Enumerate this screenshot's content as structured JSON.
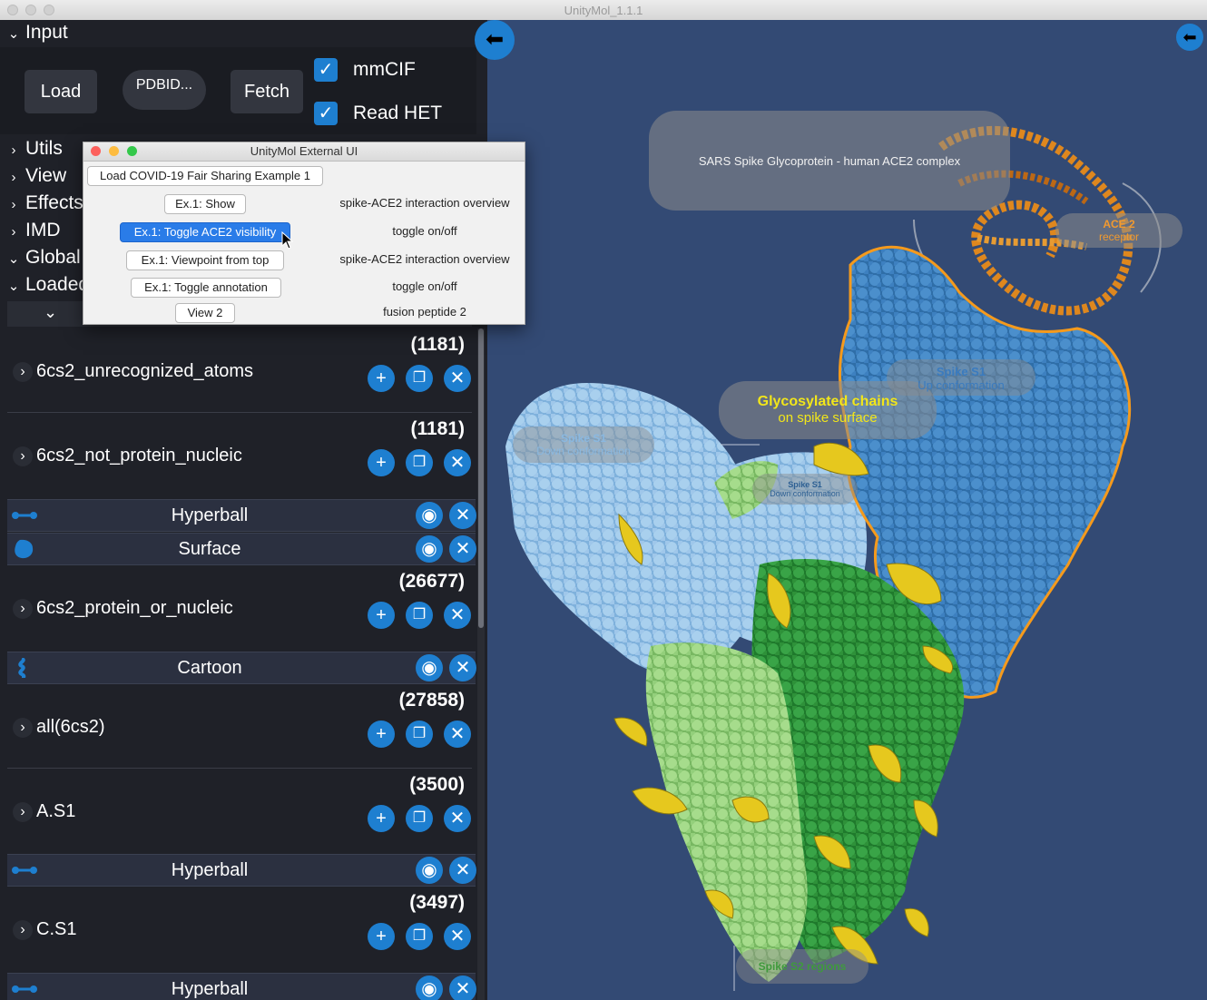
{
  "window": {
    "title": "UnityMol_1.1.1"
  },
  "input_section": {
    "header": "Input",
    "load_label": "Load",
    "pdbid_placeholder": "PDBID...",
    "fetch_label": "Fetch",
    "mmcif_label": "mmCIF",
    "mmcif_checked": true,
    "readhet_label": "Read HET",
    "readhet_checked": true
  },
  "menu_sections": [
    "Utils",
    "View",
    "Effects",
    "IMD",
    "Global",
    "Loaded"
  ],
  "selections": [
    {
      "count": "(1181)",
      "name": "6cs2_unrecognized_atoms"
    },
    {
      "count": "(1181)",
      "name": "6cs2_not_protein_nucleic"
    },
    {
      "count": "(26677)",
      "name": "6cs2_protein_or_nucleic"
    },
    {
      "count": "(27858)",
      "name": "all(6cs2)"
    },
    {
      "count": "(3500)",
      "name": "A.S1"
    },
    {
      "count": "(3497)",
      "name": "C.S1"
    }
  ],
  "representations": {
    "hyperball": "Hyperball",
    "surface": "Surface",
    "cartoon": "Cartoon"
  },
  "external_ui": {
    "title": "UnityMol External UI",
    "load_example": "Load COVID-19 Fair Sharing Example 1",
    "rows": [
      {
        "button": "Ex.1: Show",
        "desc": "spike-ACE2 interaction overview"
      },
      {
        "button": "Ex.1: Toggle ACE2 visibility",
        "desc": "toggle on/off"
      },
      {
        "button": "Ex.1: Viewpoint from top",
        "desc": "spike-ACE2 interaction overview"
      },
      {
        "button": "Ex.1: Toggle annotation",
        "desc": "toggle on/off"
      },
      {
        "button": "View 2",
        "desc": "fusion peptide 2"
      }
    ]
  },
  "annotations": {
    "main_title": "SARS Spike Glycoprotein - human ACE2 complex",
    "ace2_line1": "ACE 2",
    "ace2_line2": "receptor",
    "glyco_line1": "Glycosylated chains",
    "glyco_line2": "on spike surface",
    "spike_s1_left_1": "Spike S1",
    "spike_s1_left_2": "Down conformation",
    "spike_s1_mid_1": "Spike S1",
    "spike_s1_mid_2": "Down conformation",
    "spike_s1_up_1": "Spike S1",
    "spike_s1_up_2": "Up conformation",
    "spike_s2": "Spike S2 regions"
  },
  "colors": {
    "accent": "#1e7fd0",
    "viewport_bg": "#334a74",
    "panel_bg": "#1f2128",
    "ace2_orange": "#e88b1a",
    "glycan_yellow": "#e6c81e",
    "spike_light_blue": "#8fc0e6",
    "spike_blue": "#3f86c4",
    "spike_green": "#2f9a3e",
    "spike_light_green": "#8fd07a"
  }
}
